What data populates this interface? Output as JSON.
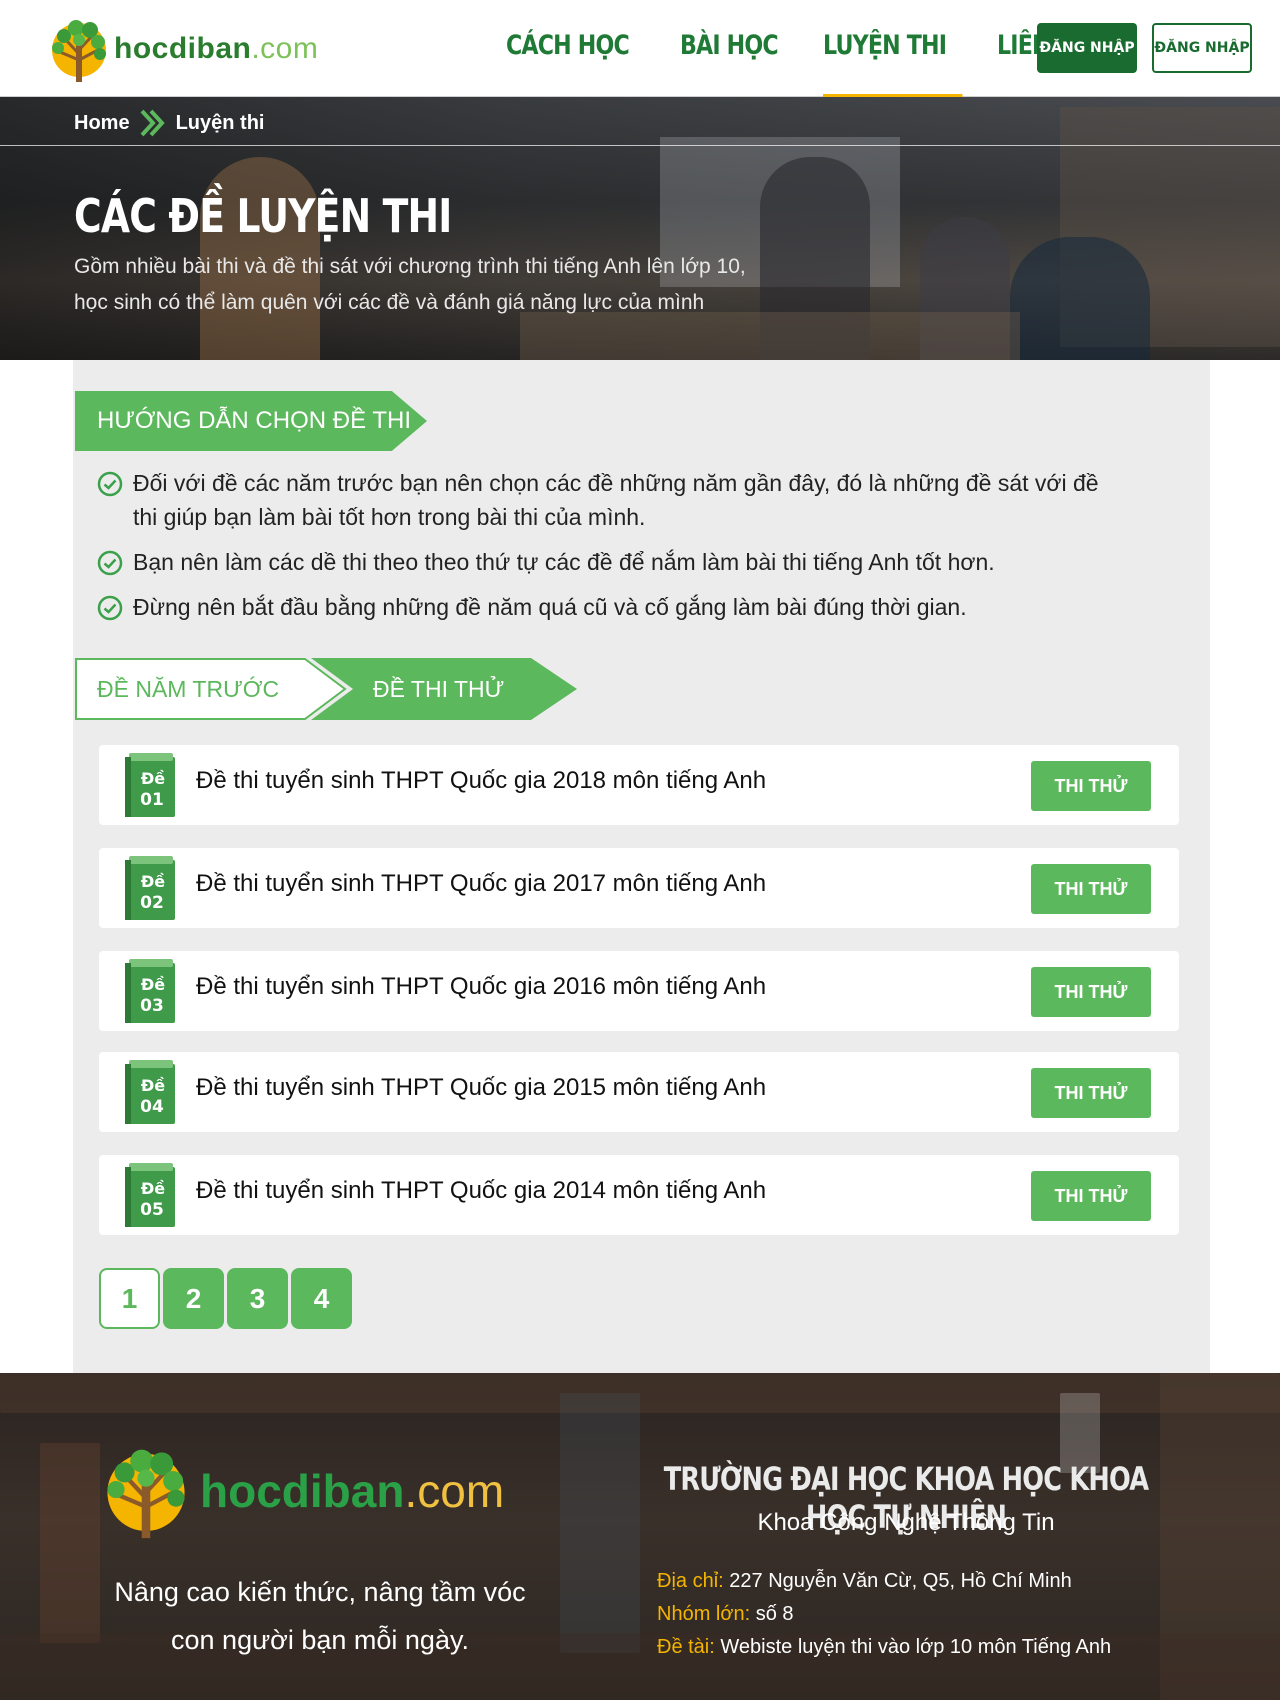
{
  "brand": {
    "name": "hocdiban",
    "domain": ".com"
  },
  "nav": {
    "items": [
      {
        "label": "CÁCH HỌC"
      },
      {
        "label": "BÀI HỌC"
      },
      {
        "label": "LUYỆN THI",
        "active": true
      },
      {
        "label": "LIÊN HỆ"
      }
    ],
    "login_primary": "ĐĂNG NHẬP",
    "login_secondary": "ĐĂNG NHẬP"
  },
  "breadcrumb": {
    "home": "Home",
    "current": "Luyện thi"
  },
  "hero": {
    "title": "CÁC ĐỀ LUYỆN THI",
    "subtitle_line1": "Gồm nhiều bài thi và đề thi sát với chương trình thi tiếng Anh lên lớp 10,",
    "subtitle_line2": "học sinh có thể làm quên với các đề và đánh giá năng lực của mình"
  },
  "guide": {
    "heading": "HƯỚNG DẪN CHỌN ĐỀ THI",
    "items": [
      "Đối với đề các năm trước bạn nên chọn các đề những năm gần đây, đó là những đề sát với đề thi giúp bạn làm bài tốt hơn trong bài thi của mình.",
      "Bạn nên làm các dề thi theo theo thứ tự các đề để nắm làm bài thi tiếng Anh tốt hơn.",
      "Đừng nên  bắt đầu bằng những đề năm quá cũ và cố gắng làm bài đúng thời gian."
    ]
  },
  "tabs": {
    "previous": "ĐỀ NĂM TRƯỚC",
    "trial": "ĐỀ THI THỬ",
    "active": "trial"
  },
  "exams": [
    {
      "badge_word": "Đề",
      "badge_num": "01",
      "title": "Đề thi tuyển sinh THPT Quốc gia 2018 môn tiếng Anh",
      "button": "THI THỬ"
    },
    {
      "badge_word": "Đề",
      "badge_num": "02",
      "title": "Đề thi tuyển sinh THPT Quốc gia 2017 môn tiếng Anh",
      "button": "THI THỬ"
    },
    {
      "badge_word": "Đề",
      "badge_num": "03",
      "title": "Đề thi tuyển sinh THPT Quốc gia 2016 môn tiếng Anh",
      "button": "THI THỬ"
    },
    {
      "badge_word": "Đề",
      "badge_num": "04",
      "title": "Đề thi tuyển sinh THPT Quốc gia 2015 môn tiếng Anh",
      "button": "THI THỬ"
    },
    {
      "badge_word": "Đề",
      "badge_num": "05",
      "title": "Đề thi tuyển sinh THPT Quốc gia 2014 môn tiếng Anh",
      "button": "THI THỬ"
    }
  ],
  "pagination": {
    "pages": [
      "1",
      "2",
      "3",
      "4"
    ],
    "current": "1"
  },
  "footer": {
    "slogan_line1": "Nâng cao kiến thức, nâng tầm vóc",
    "slogan_line2": "con người bạn mỗi ngày.",
    "school": "TRƯỜNG ĐẠI HỌC KHOA HỌC KHOA HỌC TỰ NHIÊN",
    "faculty": "Khoa Công Nghệ Thông Tin",
    "address_label": "Địa chỉ:",
    "address": "227 Nguyễn Văn Cừ, Q5, Hồ Chí Minh",
    "group_label": "Nhóm lớn:",
    "group": "số 8",
    "topic_label": "Đề tài:",
    "topic": "Webiste luyện thi vào lớp 10 môn Tiếng Anh"
  },
  "colors": {
    "brand_green": "#1a6b2f",
    "accent_green": "#5cb85c",
    "accent_yellow": "#f5b400"
  },
  "icons": {
    "check": "check-circle-icon",
    "breadcrumb_separator": "double-chevron-right-icon",
    "exam": "book-icon",
    "logo": "tree-logo-icon"
  }
}
